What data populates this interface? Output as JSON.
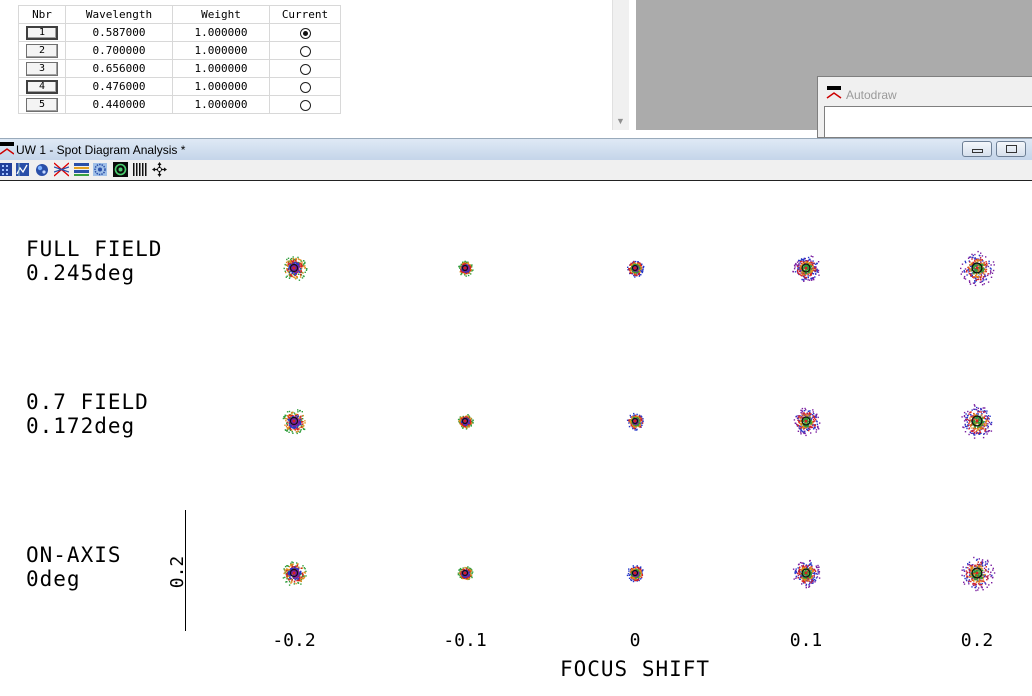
{
  "wavelength_table": {
    "headers": [
      "Nbr",
      "Wavelength",
      "Weight",
      "Current"
    ],
    "rows": [
      {
        "nbr": "1",
        "wavelength": "0.587000",
        "weight": "1.000000",
        "current": true
      },
      {
        "nbr": "2",
        "wavelength": "0.700000",
        "weight": "1.000000",
        "current": false
      },
      {
        "nbr": "3",
        "wavelength": "0.656000",
        "weight": "1.000000",
        "current": false
      },
      {
        "nbr": "4",
        "wavelength": "0.476000",
        "weight": "1.000000",
        "current": false
      },
      {
        "nbr": "5",
        "wavelength": "0.440000",
        "weight": "1.000000",
        "current": false
      }
    ]
  },
  "autodraw_window": {
    "title": "Autodraw"
  },
  "spot_window": {
    "title": "UW 1 - Spot Diagram Analysis *",
    "toolbar_icons": [
      "spot-grid-icon",
      "chart-tool-icon",
      "lens-blob-icon",
      "ray-fan-icon",
      "color-bars-icon",
      "pattern-icon",
      "target-icon",
      "barcode-icon",
      "pan-arrows-icon"
    ]
  },
  "spot_diagram": {
    "row_labels": [
      {
        "line1": "FULL FIELD",
        "line2": "0.245deg"
      },
      {
        "line1": "0.7 FIELD",
        "line2": "0.172deg"
      },
      {
        "line1": "ON-AXIS",
        "line2": "0deg"
      }
    ],
    "x_ticks": [
      "-0.2",
      "-0.1",
      "0",
      "0.1",
      "0.2"
    ],
    "x_label": "FOCUS SHIFT",
    "scale_label": "0.2",
    "wavelength_colors": {
      "0.587000": "#2e9d3b",
      "0.700000": "#d62020",
      "0.656000": "#e08a1a",
      "0.476000": "#2637c9",
      "0.440000": "#7a1fa0"
    },
    "focus_shifts": [
      -0.2,
      -0.1,
      0,
      0.1,
      0.2
    ],
    "spot_sizes": [
      [
        0.45,
        0.27,
        0.3,
        0.5,
        0.62
      ],
      [
        0.45,
        0.27,
        0.3,
        0.5,
        0.62
      ],
      [
        0.45,
        0.27,
        0.3,
        0.5,
        0.62
      ]
    ]
  }
}
